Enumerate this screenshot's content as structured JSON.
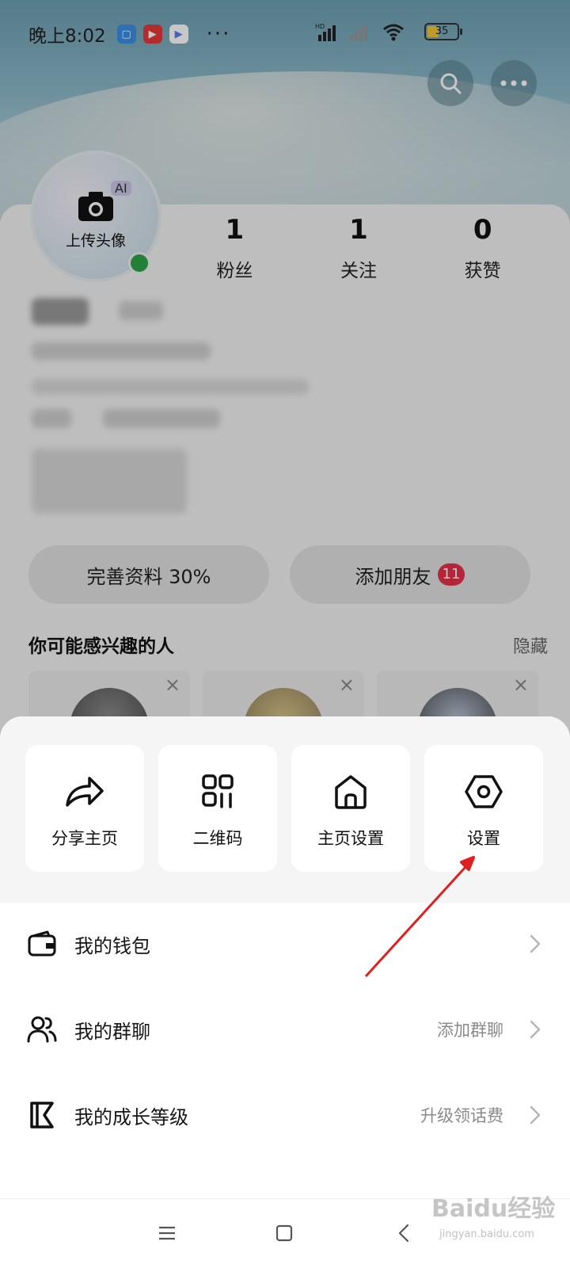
{
  "status_bar": {
    "time": "晚上8:02",
    "battery": "35",
    "dots": "···"
  },
  "profile": {
    "avatar_badge": "AI",
    "avatar_label": "上传头像",
    "stats": [
      {
        "value": "1",
        "label": "粉丝"
      },
      {
        "value": "1",
        "label": "关注"
      },
      {
        "value": "0",
        "label": "获赞"
      }
    ],
    "complete_profile_label": "完善资料 30%",
    "add_friends_label": "添加朋友",
    "add_friends_badge": "11",
    "suggestions_title": "你可能感兴趣的人",
    "suggestions_hide": "隐藏",
    "suggestion_close": "×"
  },
  "sheet": {
    "quick_actions": [
      {
        "label": "分享主页",
        "icon": "share-icon"
      },
      {
        "label": "二维码",
        "icon": "qr-code-icon"
      },
      {
        "label": "主页设置",
        "icon": "home-icon"
      },
      {
        "label": "设置",
        "icon": "settings-hexagon-icon"
      }
    ],
    "menu": [
      {
        "label": "我的钱包",
        "hint": "",
        "icon": "wallet-icon"
      },
      {
        "label": "我的群聊",
        "hint": "添加群聊",
        "icon": "group-chat-icon"
      },
      {
        "label": "我的成长等级",
        "hint": "升级领话费",
        "icon": "growth-level-icon"
      }
    ]
  },
  "nav_bar": {
    "items": [
      "menu-icon",
      "home-square-icon",
      "back-icon"
    ]
  },
  "watermark": {
    "text": "Baidu经验",
    "sub": "jingyan.baidu.com"
  },
  "colors": {
    "accent_badge": "#e8304a",
    "online": "#2ea44a",
    "annotation_arrow": "#e02020"
  }
}
